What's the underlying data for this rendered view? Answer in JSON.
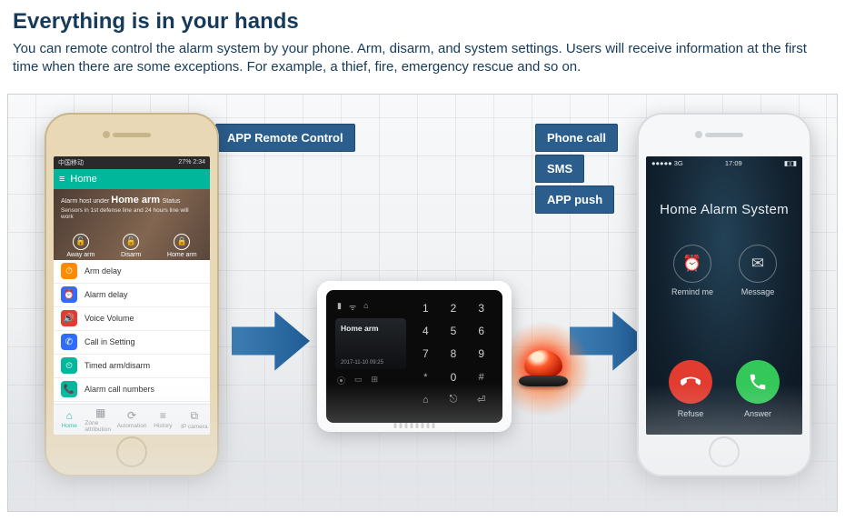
{
  "header": {
    "title": "Everything is in your hands",
    "subtitle": "You can remote control the alarm system by your phone. Arm, disarm, and system settings. Users will receive information at the first time when there are some exceptions. For example, a thief, fire, emergency rescue and so on."
  },
  "badges": {
    "remote": "APP Remote Control",
    "phonecall": "Phone call",
    "sms": "SMS",
    "apppush": "APP push"
  },
  "phone1": {
    "status_left": "中国移动",
    "status_right": "27%  2:34",
    "topbar_title": "Home",
    "hero_prefix": "Alarm host under ",
    "hero_main": "Home arm",
    "hero_suffix": " Status",
    "hero_line2": "Sensors in 1st defense line and 24 hours line will work",
    "arm_modes": [
      {
        "label": "Away arm",
        "glyph": "🔓"
      },
      {
        "label": "Disarm",
        "glyph": "🔓"
      },
      {
        "label": "Home arm",
        "glyph": "🔒"
      }
    ],
    "menu": [
      {
        "label": "Arm delay",
        "color": "#ff8a00",
        "glyph": "⏱"
      },
      {
        "label": "Alarm delay",
        "color": "#2e6cff",
        "glyph": "⏰"
      },
      {
        "label": "Voice Volume",
        "color": "#e23b30",
        "glyph": "🔊"
      },
      {
        "label": "Call in Setting",
        "color": "#2e6cff",
        "glyph": "✆"
      },
      {
        "label": "Timed arm/disarm",
        "color": "#00b79b",
        "glyph": "⏲"
      },
      {
        "label": "Alarm call numbers",
        "color": "#00b79b",
        "glyph": "📞"
      }
    ],
    "tabs": [
      {
        "label": "Home",
        "glyph": "⌂",
        "active": true
      },
      {
        "label": "Zone attribution",
        "glyph": "▦",
        "active": false
      },
      {
        "label": "Automation",
        "glyph": "⟳",
        "active": false
      },
      {
        "label": "History",
        "glyph": "≡",
        "active": false
      },
      {
        "label": "IP camera",
        "glyph": "⧉",
        "active": false
      }
    ]
  },
  "panel": {
    "lcd_text": "Home arm",
    "lcd_time": "2017-11-10  09:25",
    "keys": [
      "1",
      "2",
      "3",
      "4",
      "5",
      "6",
      "7",
      "8",
      "9",
      "*",
      "0",
      "#",
      "⌂",
      "⎋",
      "⏎"
    ]
  },
  "phone2": {
    "status_left": "●●●●●  3G",
    "status_time": "17:09",
    "status_right": "◧◨",
    "caller": "Home Alarm System",
    "action_remind": "Remind me",
    "action_message": "Message",
    "call_refuse": "Refuse",
    "call_answer": "Answer"
  }
}
